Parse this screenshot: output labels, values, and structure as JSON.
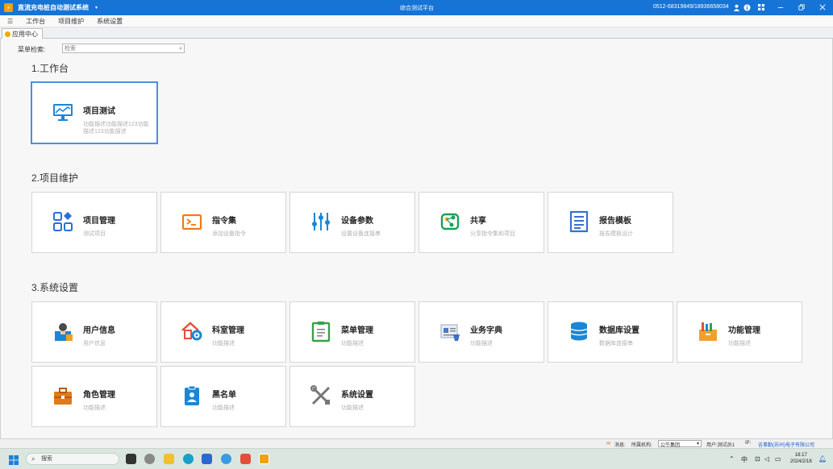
{
  "titlebar": {
    "app_title": "直流充电桩自动测试系统",
    "dropdown": "▾",
    "center_title": "综合测试平台",
    "phone": "0512-68319849/18936658034",
    "logo": "⚡",
    "icons": [
      "user-icon",
      "info-icon",
      "grid-icon",
      "minimize-icon",
      "restore-icon",
      "close-icon"
    ]
  },
  "menubar": {
    "hamburger": "☰",
    "items": [
      "工作台",
      "项目维护",
      "系统设置"
    ]
  },
  "tab": {
    "label": "应用中心"
  },
  "search": {
    "label": "菜单检索:",
    "placeholder": "检索"
  },
  "sections": {
    "s1": {
      "title": "1.工作台",
      "cards": [
        {
          "name": "项目测试",
          "desc": "功能描述功能描述123功能描述123功能描述",
          "icon": "monitor-chart-icon",
          "color": "#1a87d6"
        }
      ]
    },
    "s2": {
      "title": "2.项目维护",
      "cards": [
        {
          "name": "项目管理",
          "desc": "测试项目",
          "icon": "apps-icon",
          "color": "#2b6fd6"
        },
        {
          "name": "指令集",
          "desc": "添加设备指令",
          "icon": "terminal-icon",
          "color": "#f07a1a"
        },
        {
          "name": "设备参数",
          "desc": "设置设备连接串",
          "icon": "sliders-icon",
          "color": "#1a87d6"
        },
        {
          "name": "共享",
          "desc": "分享指令集和项目",
          "icon": "share-icon",
          "color": "#18a05a"
        },
        {
          "name": "报告模板",
          "desc": "报告模板设计",
          "icon": "report-icon",
          "color": "#3a6fcf"
        }
      ]
    },
    "s3": {
      "title": "3.系统设置",
      "cards": [
        {
          "name": "用户信息",
          "desc": "用户信息",
          "icon": "user-info-icon",
          "color": "#1a87d6"
        },
        {
          "name": "科室管理",
          "desc": "功能描述",
          "icon": "department-icon",
          "color": "#e0503a"
        },
        {
          "name": "菜单管理",
          "desc": "功能描述",
          "icon": "clipboard-icon",
          "color": "#3aa04a"
        },
        {
          "name": "业务字典",
          "desc": "功能描述",
          "icon": "dictionary-icon",
          "color": "#4a7ac8"
        },
        {
          "name": "数据库设置",
          "desc": "数据库连接串",
          "icon": "database-icon",
          "color": "#1a87d6"
        },
        {
          "name": "功能管理",
          "desc": "功能描述",
          "icon": "toolbox-icon",
          "color": "#f0a030"
        },
        {
          "name": "角色管理",
          "desc": "功能描述",
          "icon": "briefcase-icon",
          "color": "#e07a1a"
        },
        {
          "name": "黑名单",
          "desc": "功能描述",
          "icon": "blacklist-icon",
          "color": "#1a87d6"
        },
        {
          "name": "系统设置",
          "desc": "功能描述",
          "icon": "tools-icon",
          "color": "#666666"
        }
      ]
    }
  },
  "statusbar": {
    "msg_label": "消息:",
    "org_label": "所属机构:",
    "org_value": "公牛集团",
    "user": "用户:测试员1",
    "ip": "IP:",
    "company": "吉事勤(苏州)电子有限公司"
  },
  "taskbar": {
    "search": "搜索",
    "tray_up": "⌃",
    "ime": "中",
    "time": "18:17",
    "date": "2024/2/18"
  }
}
